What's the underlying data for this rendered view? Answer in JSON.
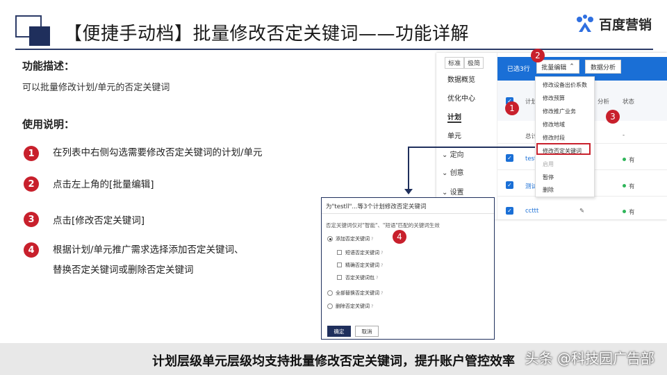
{
  "header": {
    "title": "【便捷手动档】批量修改否定关键词——功能详解",
    "logo_text": "百度营销",
    "accent": "#1f2f5c"
  },
  "left": {
    "func_label": "功能描述：",
    "func_desc": "可以批量修改计划/单元的否定关键词",
    "usage_label": "使用说明：",
    "steps": [
      {
        "num": "1",
        "text": "在列表中右侧勾选需要修改否定关键词的计划/单元"
      },
      {
        "num": "2",
        "text": "点击左上角的[批量编辑]"
      },
      {
        "num": "3",
        "text": "点击[修改否定关键词]"
      },
      {
        "num": "4",
        "line1": "根据计划/单元推广需求选择添加否定关键词、",
        "line2": "替换否定关键词或删除否定关键词"
      }
    ],
    "step_color": "#c8202c"
  },
  "panel": {
    "mode_tabs": [
      "标准",
      "极简"
    ],
    "sidebar": [
      "数据概览",
      "优化中心",
      "计划",
      "单元",
      "定向",
      "创意",
      "设置"
    ],
    "selected_label": "已选3行",
    "batch_edit": "批量编辑",
    "data_analysis": "数据分析",
    "col_plan": "计划",
    "col_analysis": "分析",
    "col_status": "状态",
    "total_label": "总计",
    "total_dash": "-",
    "rows": [
      "testl",
      "测试",
      "ccttt"
    ],
    "row_status": [
      "有",
      "有",
      "有"
    ],
    "bar_color": "#1a6fd6",
    "dropdown": [
      {
        "label": "修改设备出价系数",
        "disabled": false
      },
      {
        "label": "修改预算",
        "disabled": false
      },
      {
        "label": "修改推广业务",
        "disabled": false
      },
      {
        "label": "修改地域",
        "disabled": false
      },
      {
        "label": "修改时段",
        "disabled": false
      },
      {
        "label": "修改否定关键词",
        "disabled": false,
        "highlight": true
      },
      {
        "label": "启用",
        "disabled": true
      },
      {
        "label": "暂停",
        "disabled": false
      },
      {
        "label": "删除",
        "disabled": false
      }
    ],
    "markers": [
      "1",
      "2",
      "3"
    ]
  },
  "dialog": {
    "title": "为\"testll\"...等3个计划修改否定关键词",
    "hint": "否定关键词仅对\"智能\"、\"短语\"匹配的关键词生效",
    "marker": "4",
    "opt_add": "添加否定关键词",
    "sub_opts": [
      "短语否定关键词",
      "精确否定关键词",
      "否定关键词包"
    ],
    "opt_replace": "全部替换否定关键词",
    "opt_delete": "删除否定关键词",
    "help_mark": "?",
    "ok": "确定",
    "cancel": "取消"
  },
  "footer": {
    "banner": "计划层级单元层级均支持批量修改否定关键词，提升账户管控效率",
    "watermark": "头条 @科技园广告部"
  }
}
